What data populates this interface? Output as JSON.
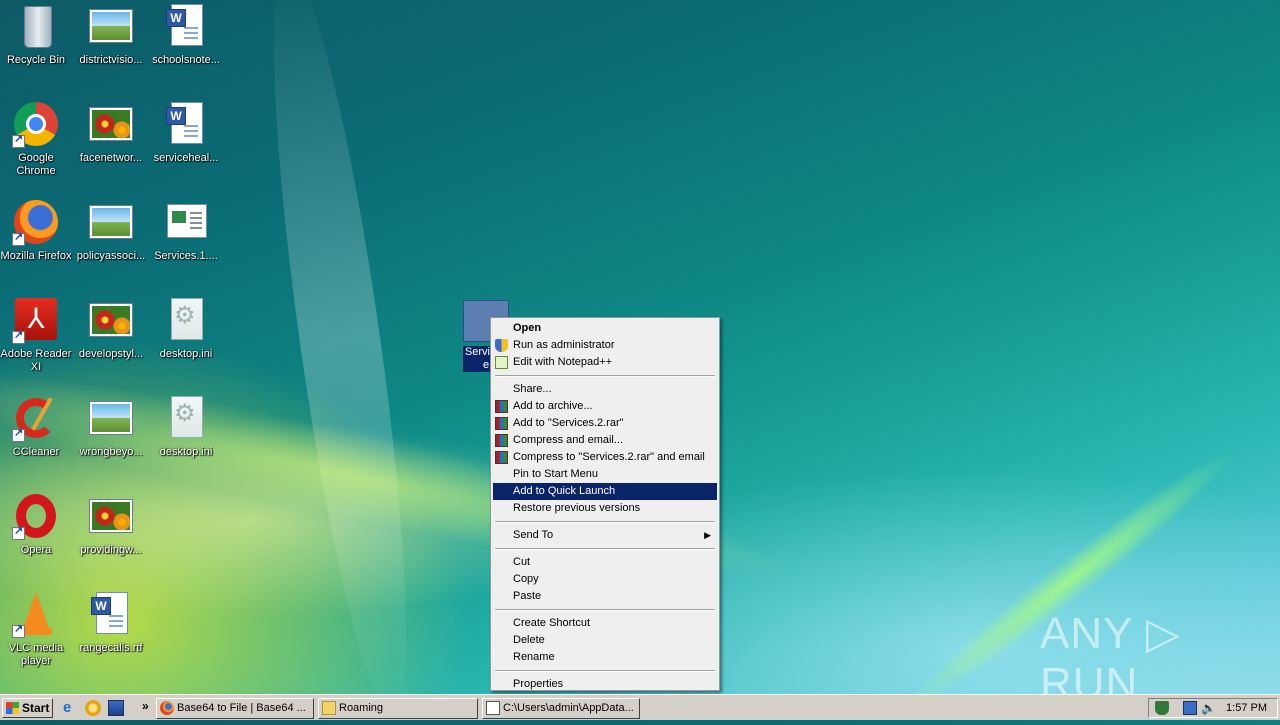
{
  "desktop": {
    "icons": [
      {
        "label": "Recycle Bin"
      },
      {
        "label": "districtvisio..."
      },
      {
        "label": "schoolsnote..."
      },
      {
        "label": "Google Chrome"
      },
      {
        "label": "facenetwor..."
      },
      {
        "label": "serviceheal..."
      },
      {
        "label": "Mozilla Firefox"
      },
      {
        "label": "policyassoci..."
      },
      {
        "label": "Services.1...."
      },
      {
        "label": "Adobe Reader XI"
      },
      {
        "label": "developstyl..."
      },
      {
        "label": "desktop.ini"
      },
      {
        "label": "CCleaner"
      },
      {
        "label": "wrongbeyo..."
      },
      {
        "label": "desktop.ini"
      },
      {
        "label": "Opera"
      },
      {
        "label": "providingw..."
      },
      {
        "label": "VLC media player"
      },
      {
        "label": "rangecalls.rtf"
      }
    ],
    "selected_icon": {
      "label": "Services",
      "label_line2": "e"
    }
  },
  "context_menu": {
    "items": [
      {
        "label": "Open"
      },
      {
        "label": "Run as administrator"
      },
      {
        "label": "Edit with Notepad++"
      },
      {
        "label": "Share..."
      },
      {
        "label": "Add to archive..."
      },
      {
        "label": "Add to \"Services.2.rar\""
      },
      {
        "label": "Compress and email..."
      },
      {
        "label": "Compress to \"Services.2.rar\" and email"
      },
      {
        "label": "Pin to Start Menu"
      },
      {
        "label": "Add to Quick Launch"
      },
      {
        "label": "Restore previous versions"
      },
      {
        "label": "Send To"
      },
      {
        "label": "Cut"
      },
      {
        "label": "Copy"
      },
      {
        "label": "Paste"
      },
      {
        "label": "Create Shortcut"
      },
      {
        "label": "Delete"
      },
      {
        "label": "Rename"
      },
      {
        "label": "Properties"
      }
    ],
    "highlighted": "Add to Quick Launch"
  },
  "watermark": {
    "text": "ANY ▷ RUN"
  },
  "taskbar": {
    "start_label": "Start",
    "chevron": "»",
    "tasks": [
      {
        "label": "Base64 to File | Base64 ..."
      },
      {
        "label": "Roaming"
      },
      {
        "label": "C:\\Users\\admin\\AppData..."
      }
    ],
    "clock": "1:57 PM"
  },
  "colors": {
    "highlight": "#0a246a",
    "taskbar": "#d4d0c8",
    "menu_bg": "#f0efef"
  }
}
